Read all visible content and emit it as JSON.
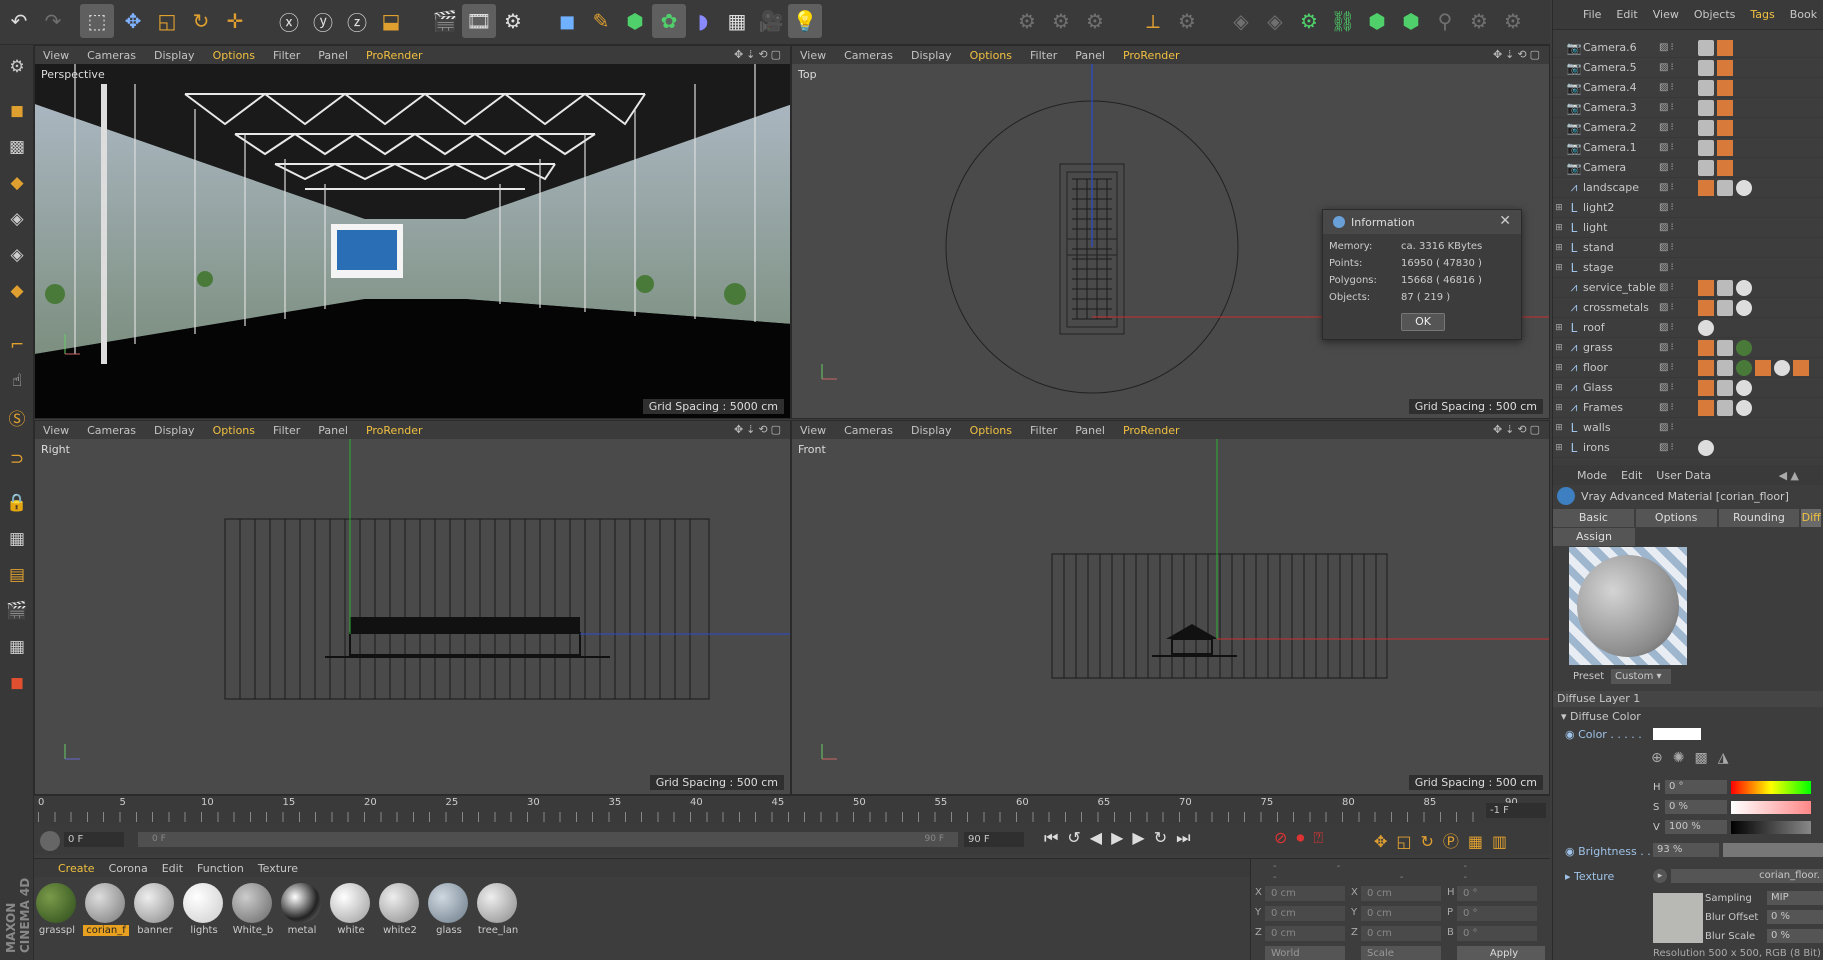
{
  "viewport_menu": [
    "View",
    "Cameras",
    "Display",
    "Options",
    "Filter",
    "Panel",
    "ProRender"
  ],
  "viewports": {
    "perspective": {
      "label": "Perspective",
      "grid": "Grid Spacing : 5000 cm"
    },
    "top": {
      "label": "Top",
      "grid": "Grid Spacing : 500 cm"
    },
    "right": {
      "label": "Right",
      "grid": "Grid Spacing : 500 cm"
    },
    "front": {
      "label": "Front",
      "grid": "Grid Spacing : 500 cm"
    }
  },
  "info_dialog": {
    "title": "Information",
    "memory_label": "Memory:",
    "memory": "ca. 3316 KBytes",
    "points_label": "Points:",
    "points": "16950 ( 47830 )",
    "polygons_label": "Polygons:",
    "polygons": "15668 ( 46816 )",
    "objects_label": "Objects:",
    "objects": "87 ( 219 )",
    "ok": "OK"
  },
  "object_manager": {
    "menu": [
      "File",
      "Edit",
      "View",
      "Objects",
      "Tags",
      "Book"
    ],
    "objects": [
      "Camera.6",
      "Camera.5",
      "Camera.4",
      "Camera.3",
      "Camera.2",
      "Camera.1",
      "Camera",
      "landscape",
      "light2",
      "light",
      "stand",
      "stage",
      "service_table",
      "crossmetals",
      "roof",
      "grass",
      "floor",
      "Glass",
      "Frames",
      "walls",
      "irons"
    ]
  },
  "attribute_manager": {
    "menu": [
      "Mode",
      "Edit",
      "User Data"
    ],
    "title": "Vray Advanced Material [corian_floor]",
    "tabs": [
      "Basic",
      "Options",
      "Rounding",
      "Diff"
    ],
    "assign": "Assign",
    "preset_label": "Preset",
    "preset": "Custom",
    "section": "Diffuse Layer 1",
    "subsection": "Diffuse Color",
    "color_label": "Color . . . . .",
    "h": "0 °",
    "s": "0 %",
    "v": "100 %",
    "brightness_label": "Brightness . .",
    "brightness": "93 %",
    "texture_label": "Texture",
    "texture": "corian_floor.",
    "sampling_label": "Sampling",
    "sampling": "MIP",
    "blur_offset_label": "Blur Offset",
    "blur_offset": "0 %",
    "blur_scale_label": "Blur Scale",
    "blur_scale": "0 %",
    "resolution": "Resolution 500 x 500, RGB (8 Bit)"
  },
  "timeline": {
    "ticks": [
      "0",
      "5",
      "10",
      "15",
      "20",
      "25",
      "30",
      "35",
      "40",
      "45",
      "50",
      "55",
      "60",
      "65",
      "70",
      "75",
      "80",
      "85",
      "90"
    ],
    "current": "-1 F",
    "start": "0 F",
    "range_start": "0 F",
    "range_end": "90 F",
    "end": "90 F"
  },
  "material_manager": {
    "menu": [
      "Create",
      "Corona",
      "Edit",
      "Function",
      "Texture"
    ],
    "materials": [
      "grasspl",
      "corian_f",
      "banner",
      "lights",
      "White_b",
      "metal",
      "white",
      "white2",
      "glass",
      "tree_lan"
    ]
  },
  "coordinates": {
    "x": "0 cm",
    "y": "0 cm",
    "z": "0 cm",
    "sx": "0 cm",
    "sy": "0 cm",
    "sz": "0 cm",
    "h": "0 °",
    "p": "0 °",
    "b": "0 °",
    "world": "World",
    "scale": "Scale",
    "apply": "Apply"
  },
  "brand": "MAXON CINEMA 4D"
}
